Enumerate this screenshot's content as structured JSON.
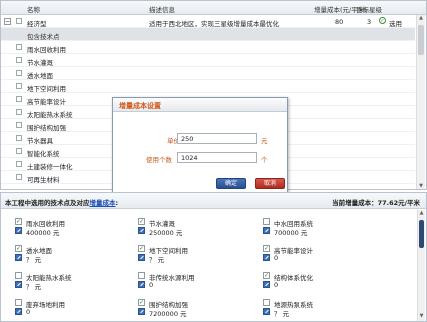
{
  "table": {
    "headers": {
      "name": "名称",
      "description": "描述信息",
      "cost": "增量成本(元/平米)",
      "target_level": "目标星级",
      "selected": "选用"
    },
    "scheme": {
      "name": "经济型",
      "description": "适用于西北地区，实现三星级增量成本最优化",
      "cost": "80",
      "target_level": "3",
      "selected": "选用"
    },
    "group_label": "包含技术点",
    "items": [
      "雨水回收利用",
      "节水灌溉",
      "透水地面",
      "地下空间利用",
      "高节能率设计",
      "太阳能热水系统",
      "围护结构加强",
      "节水器具",
      "智能化系统",
      "土建装修一体化",
      "可再生材料"
    ]
  },
  "dialog": {
    "title": "增量成本设置",
    "unit_price_label": "单价",
    "unit_price_value": "250",
    "unit_price_unit": "元",
    "count_label": "使用个数",
    "count_value": "1024",
    "count_unit": "个",
    "ok": "确定",
    "cancel": "取消"
  },
  "bottom": {
    "title_prefix": "本工程中选用的技术点及对应",
    "title_link": "增量成本",
    "title_suffix": ":",
    "current_cost": "当前增量成本：77.62元/平米",
    "items": [
      {
        "name": "雨水回收利用",
        "value": "400000 元",
        "checked": true
      },
      {
        "name": "节水灌溉",
        "value": "250000 元",
        "checked": true
      },
      {
        "name": "中水回用系统",
        "value": "700000 元",
        "checked": false
      },
      {
        "name": "透水地面",
        "value": "？ 元",
        "checked": true
      },
      {
        "name": "地下空间利用",
        "value": "？ 元",
        "checked": true
      },
      {
        "name": "高节能率设计",
        "value": "0",
        "checked": true
      },
      {
        "name": "太阳能热水系统",
        "value": "？ 元",
        "checked": false
      },
      {
        "name": "非传统水源利用",
        "value": "0",
        "checked": false
      },
      {
        "name": "结构体系优化",
        "value": "0",
        "checked": true
      },
      {
        "name": "废弃场地利用",
        "value": "0",
        "checked": false
      },
      {
        "name": "围护结构加强",
        "value": "7200000 元",
        "checked": true
      },
      {
        "name": "地源热泵系统",
        "value": "？ 元",
        "checked": false
      }
    ]
  },
  "colors": {
    "accent": "#d4581a",
    "link": "#1a4fb8",
    "ok_button": "#2a4f8f",
    "cancel_button": "#ad2d22",
    "group_row": "#dfe3e8"
  }
}
